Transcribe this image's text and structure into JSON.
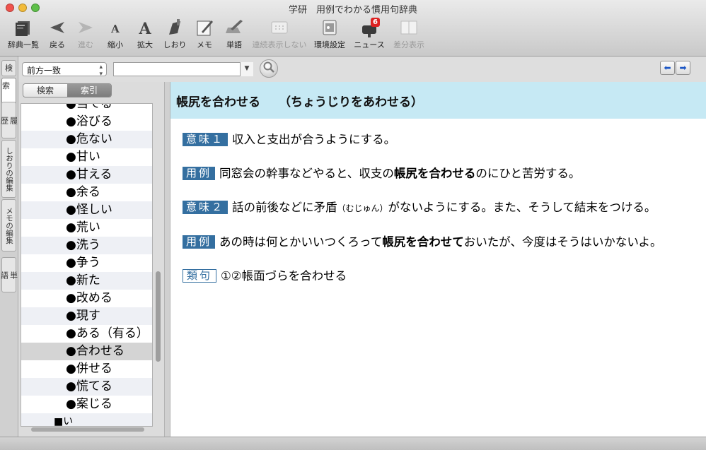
{
  "window": {
    "title": "学研　用例でわかる慣用句辞典"
  },
  "toolbar": {
    "items": [
      {
        "label": "辞典一覧",
        "icon": "dictionary-books-icon",
        "enabled": true
      },
      {
        "label": "戻る",
        "icon": "back-arrow-icon",
        "enabled": true
      },
      {
        "label": "進む",
        "icon": "forward-arrow-icon",
        "enabled": false
      },
      {
        "label": "縮小",
        "icon": "font-smaller-icon",
        "enabled": true
      },
      {
        "label": "拡大",
        "icon": "font-larger-icon",
        "enabled": true
      },
      {
        "label": "しおり",
        "icon": "bookmark-icon",
        "enabled": true
      },
      {
        "label": "メモ",
        "icon": "memo-icon",
        "enabled": true
      },
      {
        "label": "単語",
        "icon": "word-icon",
        "enabled": true
      },
      {
        "label": "連続表示しない",
        "icon": "continuous-display-icon",
        "enabled": false
      },
      {
        "label": "環境設定",
        "icon": "preferences-icon",
        "enabled": true
      },
      {
        "label": "ニュース",
        "icon": "news-mailbox-icon",
        "enabled": true,
        "badge": "6"
      },
      {
        "label": "差分表示",
        "icon": "diff-display-icon",
        "enabled": false
      }
    ]
  },
  "side_tabs": [
    {
      "label": "検",
      "name": "tab-search"
    },
    {
      "label": "索",
      "name": "tab-index"
    },
    {
      "label": "履\n歴",
      "name": "tab-history"
    },
    {
      "label": "しおりの編集",
      "name": "tab-bookmark-edit"
    },
    {
      "label": "メモの編集",
      "name": "tab-memo-edit"
    },
    {
      "label": "単\n語",
      "name": "tab-words"
    }
  ],
  "search": {
    "mode": "前方一致",
    "query": "",
    "placeholder": ""
  },
  "segment": {
    "search_label": "検索",
    "index_label": "索引",
    "selected": "索引"
  },
  "index_list": {
    "top_partial": "●当てる",
    "items": [
      "●浴びる",
      "●危ない",
      "●甘い",
      "●甘える",
      "●余る",
      "●怪しい",
      "●荒い",
      "●洗う",
      "●争う",
      "●新た",
      "●改める",
      "●現す",
      "●ある（有る）",
      "●合わせる",
      "●併せる",
      "●慌てる",
      "●案じる"
    ],
    "selected": "●合わせる",
    "bottom_partial": "■い"
  },
  "entry": {
    "headword": "帳尻を合わせる",
    "reading": "（ちょうじりをあわせる）",
    "senses": [
      {
        "badge": "意味１",
        "pre": "収入と支出が合うようにする。",
        "bold": "",
        "post": "",
        "small": "",
        "post2": ""
      },
      {
        "badge": "用例",
        "pre": "同窓会の幹事などやると、収支の",
        "bold": "帳尻を合わせる",
        "post": "のにひと苦労する。",
        "small": "",
        "post2": ""
      },
      {
        "badge": "意味２",
        "pre": "話の前後などに矛盾",
        "bold": "",
        "post": "",
        "small": "（むじゅん）",
        "post2": "がないようにする。また、そうして結末をつける。"
      },
      {
        "badge": "用例",
        "pre": "あの時は何とかいいつくろって",
        "bold": "帳尻を合わせて",
        "post": "おいたが、今度はそうはいかないよ。",
        "small": "",
        "post2": ""
      }
    ],
    "related": {
      "badge": "類句",
      "text": "①②帳面づらを合わせる"
    }
  },
  "colors": {
    "headword_bg": "#c6e9f4",
    "badge": "#346fa0",
    "selection": "#d4d4d4"
  }
}
